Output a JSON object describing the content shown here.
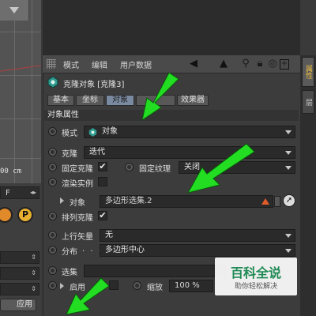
{
  "viewport": {
    "scale_label": "00 cm"
  },
  "left_panel": {
    "f_label": "F",
    "apply_label": "应用"
  },
  "menubar": {
    "items": [
      "模式",
      "编辑",
      "用户数据"
    ]
  },
  "object": {
    "title": "克隆对象 [克隆3]"
  },
  "tabs": [
    {
      "label": "基本",
      "active": false
    },
    {
      "label": "坐标",
      "active": false
    },
    {
      "label": "对象",
      "active": true
    },
    {
      "label": "",
      "active": false
    },
    {
      "label": "效果器",
      "active": false
    }
  ],
  "section_title": "对象属性",
  "props": {
    "mode_label": "模式",
    "mode_value": "对象",
    "clone_label": "克隆",
    "clone_value": "迭代",
    "fixed_clone_label": "固定克隆",
    "fixed_texture_label": "固定纹理",
    "fixed_texture_value": "关闭",
    "render_instance_label": "渲染实例",
    "object_label": "对象",
    "object_value": "多边形选集.2",
    "sort_clone_label": "排列克隆",
    "up_vector_label": "上行矢量",
    "up_vector_value": "无",
    "distribution_label": "分布",
    "distribution_value": "多边形中心",
    "selection_label": "选集",
    "enable_label": "启用",
    "scale_label": "缩放",
    "scale_value": "100 %"
  },
  "right_tabs": [
    "属性",
    "层"
  ],
  "watermark": {
    "title": "百科全说",
    "subtitle": "助你轻松解决"
  },
  "colors": {
    "arrow": "#22dd22",
    "tab_active": "#7a8aa0",
    "panel": "#3c3c3c"
  }
}
